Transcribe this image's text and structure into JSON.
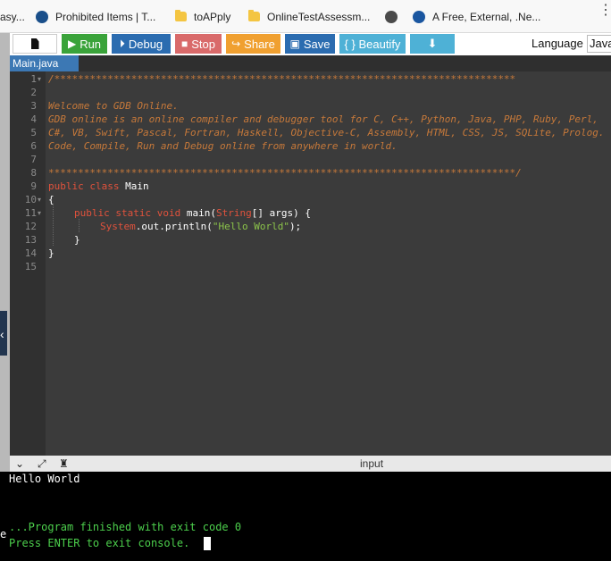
{
  "bookmarks": [
    {
      "label": "asy...",
      "icon": "truncated-favicon"
    },
    {
      "label": "Prohibited Items | T...",
      "icon": "tsa-seal-icon"
    },
    {
      "label": "toAPply",
      "icon": "folder-icon"
    },
    {
      "label": "OnlineTestAssessm...",
      "icon": "folder-icon"
    },
    {
      "label": "",
      "icon": "globe-icon"
    },
    {
      "label": "A Free, External, .Ne...",
      "icon": "site-logo-icon"
    }
  ],
  "toolbar": {
    "run": "Run",
    "debug": "Debug",
    "stop": "Stop",
    "share": "Share",
    "save": "Save",
    "beautify": "{ } Beautify",
    "language_label": "Language",
    "language_value": "Java"
  },
  "editor": {
    "tab": "Main.java",
    "line_numbers": [
      "1",
      "2",
      "3",
      "4",
      "5",
      "6",
      "7",
      "8",
      "9",
      "10",
      "11",
      "12",
      "13",
      "14",
      "15"
    ]
  },
  "code": {
    "l1": "/******************************************************************************",
    "l3": "Welcome to GDB Online.",
    "l4": "GDB online is an online compiler and debugger tool for C, C++, Python, Java, PHP, Ruby, Perl,",
    "l5": "C#, VB, Swift, Pascal, Fortran, Haskell, Objective-C, Assembly, HTML, CSS, JS, SQLite, Prolog.",
    "l6": "Code, Compile, Run and Debug online from anywhere in world.",
    "l8": "*******************************************************************************/",
    "l9_kw": "public class ",
    "l9_name": "Main",
    "l10": "{",
    "l11_kw": "public static void ",
    "l11_mid": "main(",
    "l11_type": "String",
    "l11_end": "[] args) {",
    "l12_sys": "System",
    "l12_mid": ".out.println(",
    "l12_str": "\"Hello World\"",
    "l12_end": ");",
    "l13": "}",
    "l14": "}"
  },
  "console": {
    "input_label": "input",
    "output_line": "Hello World",
    "finish_line": "...Program finished with exit code 0",
    "press_line": "Press ENTER to exit console."
  },
  "colors": {
    "run": "#3aa33a",
    "debug": "#2b6cb0",
    "stop": "#d96a6a",
    "share": "#f0a030",
    "save": "#2b6cb0",
    "beautify": "#4eb1d6",
    "comment": "#c7793a",
    "keyword": "#e0523c",
    "string": "#8bc34a",
    "console_green": "#4ccf4c"
  }
}
